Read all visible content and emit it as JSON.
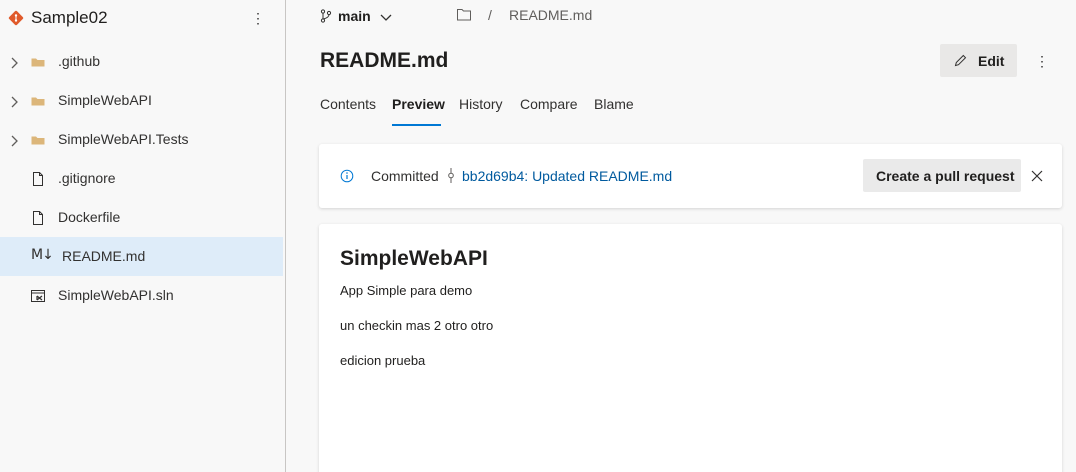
{
  "sidebar": {
    "repo_name": "Sample02",
    "more_label": "⋮",
    "items": [
      {
        "label": ".github",
        "type": "folder",
        "expandable": true
      },
      {
        "label": "SimpleWebAPI",
        "type": "folder",
        "expandable": true
      },
      {
        "label": "SimpleWebAPI.Tests",
        "type": "folder",
        "expandable": true
      },
      {
        "label": ".gitignore",
        "type": "file",
        "expandable": false
      },
      {
        "label": "Dockerfile",
        "type": "file",
        "expandable": false
      },
      {
        "label": "README.md",
        "type": "markdown",
        "expandable": false,
        "selected": true,
        "glyph": "M↓"
      },
      {
        "label": "SimpleWebAPI.sln",
        "type": "solution",
        "expandable": false
      }
    ]
  },
  "header": {
    "branch": "main",
    "path_separator": "/",
    "path_file": "README.md"
  },
  "main": {
    "title": "README.md",
    "edit_label": "Edit",
    "more_label": "⋮",
    "tabs": [
      {
        "label": "Contents"
      },
      {
        "label": "Preview",
        "active": true
      },
      {
        "label": "History"
      },
      {
        "label": "Compare"
      },
      {
        "label": "Blame"
      }
    ]
  },
  "commit_banner": {
    "label": "Committed",
    "link": "bb2d69b4: Updated README.md",
    "pr_button": "Create a pull request"
  },
  "preview": {
    "heading": "SimpleWebAPI",
    "paragraphs": [
      "App Simple para demo",
      "un checkin mas 2 otro otro",
      "edicion prueba"
    ]
  },
  "colors": {
    "accent": "#0078d4",
    "link": "#005a9e",
    "selected_row": "#deecf9",
    "folder": "#dcb67a",
    "repo_logo": "#e05a2b"
  }
}
